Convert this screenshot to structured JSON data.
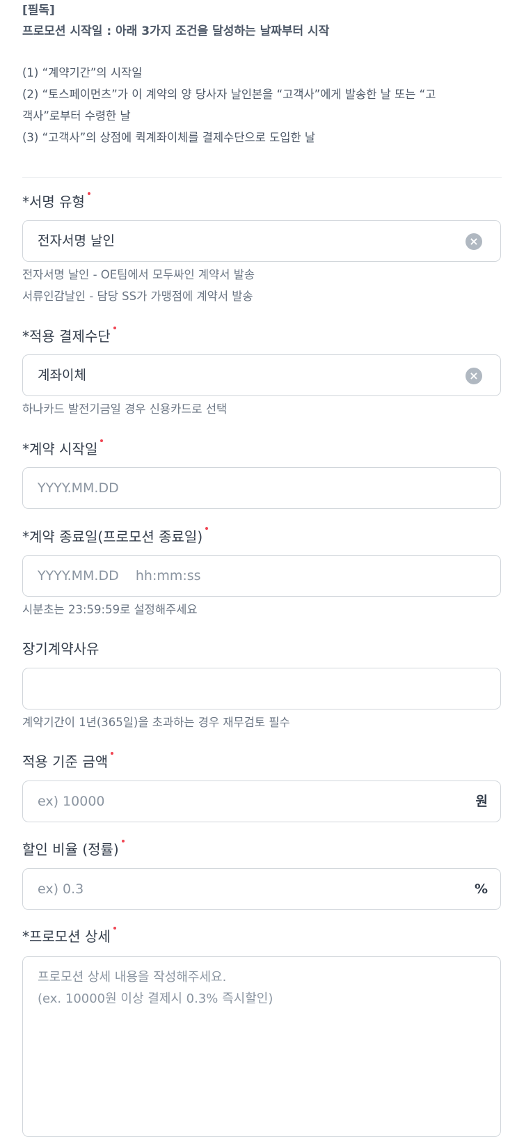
{
  "notice": {
    "tag": "[필독]",
    "title": "프로모션 시작일 : 아래 3가지 조건을 달성하는 날짜부터 시작",
    "lines": [
      "(1) “계약기간”의 시작일",
      "(2) “토스페이먼츠”가 이 계약의 양 당사자 날인본을 “고객사”에게 발송한 날 또는 “고",
      "객사”로부터 수령한 날",
      "(3) “고객사”의 상점에 퀵계좌이체를 결제수단으로 도입한  날"
    ]
  },
  "sign_type": {
    "label": "*서명 유형",
    "value": "전자서명 날인",
    "help": [
      "전자서명 날인 - OE팀에서 모두싸인 계약서 발송",
      "서류인감날인 - 담당 SS가 가맹점에 계약서 발송"
    ]
  },
  "payment_method": {
    "label": "*적용 결제수단",
    "value": "계좌이체",
    "help": "하나카드 발전기금일 경우 신용카드로 선택"
  },
  "contract_start": {
    "label": "*계약 시작일",
    "placeholder": "YYYY.MM.DD"
  },
  "contract_end": {
    "label": "*계약 종료일(프로모션 종료일)",
    "placeholder": "YYYY.MM.DD    hh:mm:ss",
    "help": "시분초는 23:59:59로 설정해주세요"
  },
  "long_term_reason": {
    "label": "장기계약사유",
    "value": "",
    "help": "계약기간이 1년(365일)을 초과하는 경우 재무검토 필수"
  },
  "base_amount": {
    "label": "적용 기준 금액",
    "placeholder": "ex) 10000",
    "suffix": "원"
  },
  "discount_rate": {
    "label": "할인 비율 (정률)",
    "placeholder": "ex) 0.3",
    "suffix": "%"
  },
  "promotion_detail": {
    "label": "*프로모션 상세",
    "placeholder_lines": [
      "프로모션 상세 내용을 작성해주세요.",
      "(ex. 10000원 이상 결제시 0.3% 즉시할인)"
    ]
  },
  "colors": {
    "required_dot": "#f04452",
    "border": "#d1d6db",
    "placeholder": "#8b95a1",
    "text": "#333d4b",
    "help": "#6b7684"
  },
  "icons": {
    "clear": "x-circle-icon"
  }
}
